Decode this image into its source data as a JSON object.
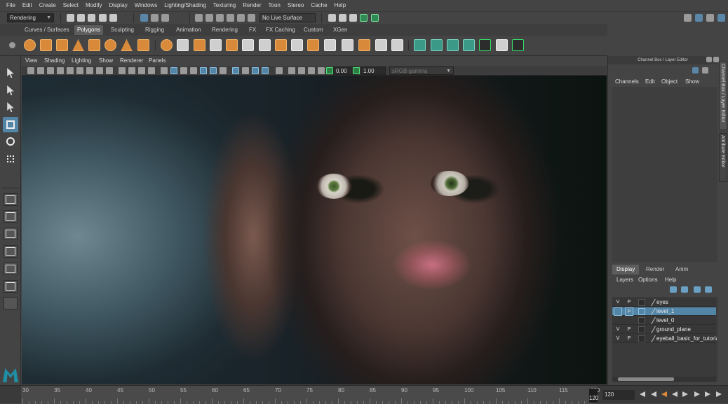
{
  "menu": [
    "File",
    "Edit",
    "Create",
    "Select",
    "Modify",
    "Display",
    "Windows",
    "Lighting/Shading",
    "Texturing",
    "Render",
    "Toon",
    "Stereo",
    "Cache",
    "Help"
  ],
  "status": {
    "menuset": "Rendering",
    "live_surface": "No Live Surface"
  },
  "shelf_tabs": [
    "Curves / Surfaces",
    "Polygons",
    "Sculpting",
    "Rigging",
    "Animation",
    "Rendering",
    "FX",
    "FX Caching",
    "Custom",
    "XGen"
  ],
  "shelf_active": "Polygons",
  "panel_menu": [
    "View",
    "Shading",
    "Lighting",
    "Show",
    "Renderer",
    "Panels"
  ],
  "viewport_toolbar": {
    "exposure": "0.00",
    "gamma": "1.00",
    "color_space": "sRGB gamma"
  },
  "channel_box": {
    "title": "Channel Box / Layer Editor",
    "menu": [
      "Channels",
      "Edit",
      "Object",
      "Show"
    ]
  },
  "side_tabs": {
    "channel_box": "Channel Box / Layer Editor",
    "attribute_editor": "Attribute Editor"
  },
  "layer_editor": {
    "tabs": [
      "Display",
      "Render",
      "Anim"
    ],
    "menu": [
      "Layers",
      "Options",
      "Help"
    ],
    "layers": [
      {
        "v": "V",
        "p": "P",
        "name": "eyes",
        "selected": false
      },
      {
        "v": "",
        "p": "P",
        "name": "level_1",
        "selected": true
      },
      {
        "v": "",
        "p": "",
        "name": "level_0",
        "selected": false
      },
      {
        "v": "V",
        "p": "P",
        "name": "ground_plane",
        "selected": false
      },
      {
        "v": "V",
        "p": "P",
        "name": "eyeball_basic_for_tutorial",
        "selected": false
      }
    ]
  },
  "timeline": {
    "ticks": [
      "30",
      "35",
      "40",
      "45",
      "50",
      "55",
      "60",
      "65",
      "70",
      "75",
      "80",
      "85",
      "90",
      "95",
      "100",
      "105",
      "110",
      "115",
      "120"
    ],
    "end_label": "120",
    "current_frame": "120"
  },
  "colors": {
    "accent": "#5285a6",
    "shelf_orange": "#d9893a",
    "bg": "#444444"
  }
}
